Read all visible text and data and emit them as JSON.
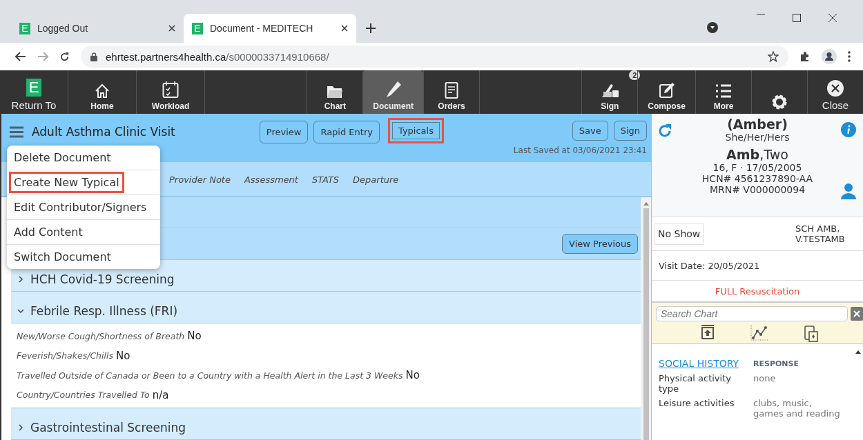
{
  "browser": {
    "tabs": [
      {
        "favicon": "E",
        "title": "Logged Out",
        "selected": false
      },
      {
        "favicon": "E",
        "title": "Document - MEDITECH",
        "selected": true
      }
    ],
    "url_host": "ehrtest.partners4health.ca",
    "url_path": "/s0000033714910668/"
  },
  "toolbar": {
    "items": [
      {
        "logo": "E",
        "label": "Return To",
        "selected": false
      },
      {
        "label": "Home",
        "selected": false
      },
      {
        "label": "Workload",
        "selected": false
      },
      {
        "label": "Chart",
        "selected": false
      },
      {
        "label": "Document",
        "selected": true
      },
      {
        "label": "Orders",
        "selected": false
      },
      {
        "label": "Sign",
        "selected": false,
        "badge": "2"
      },
      {
        "label": "Compose",
        "selected": false
      },
      {
        "label": "More",
        "selected": false
      },
      {
        "selected": false
      },
      {
        "label": "Close",
        "selected": false
      }
    ]
  },
  "document": {
    "title": "Adult Asthma Clinic Visit",
    "buttons": [
      {
        "label": "Preview",
        "highlighted": false
      },
      {
        "label": "Rapid Entry",
        "highlighted": false
      },
      {
        "label": "Typicals",
        "highlighted": true
      }
    ],
    "right_buttons": [
      {
        "label": "Save"
      },
      {
        "label": "Sign"
      }
    ],
    "last_saved": "Last Saved at 03/06/2021 23:41",
    "tabs": [
      "Provider Note",
      "Assessment",
      "STATS",
      "Departure"
    ],
    "view_previous": "View Previous",
    "sections": [
      {
        "title": "HCH Covid-19 Screening",
        "expanded": false
      },
      {
        "title": "Febrile Resp. Illness (FRI)",
        "expanded": true,
        "fields": [
          {
            "label": "New/Worse Cough/Shortness of Breath",
            "value": "No"
          },
          {
            "label": "Feverish/Shakes/Chills",
            "value": "No"
          },
          {
            "label": "Travelled Outside of Canada or Been to a Country with a Health Alert in the Last 3 Weeks",
            "value": "No"
          },
          {
            "label": "Country/Countries Travelled To",
            "value": "n/a"
          }
        ]
      },
      {
        "title": "Gastrointestinal Screening",
        "expanded": false
      }
    ]
  },
  "menu": {
    "items": [
      {
        "label": "Delete Document",
        "highlighted": false
      },
      {
        "label": "Create New Typical",
        "highlighted": true
      },
      {
        "label": "Edit Contributor/Signers",
        "highlighted": false
      },
      {
        "label": "Add Content",
        "highlighted": false
      },
      {
        "label": "Switch Document",
        "highlighted": false
      }
    ]
  },
  "patient": {
    "preferred_name": "(Amber)",
    "pronouns": "She/Her/Hers",
    "surname": "Amb",
    "given_name": ",Two",
    "age_sex_dob": "16, F · 17/05/2005",
    "hcn": "HCN# 4561237890-AA",
    "mrn": "MRN# V000000094",
    "status_button": "No Show",
    "provider": "SCH AMB, V.TESTAMB",
    "visit_date": "Visit Date: 20/05/2021",
    "code_status": "FULL Resuscitation",
    "search": {
      "placeholder": "Search Chart"
    },
    "history": {
      "heading": "SOCIAL HISTORY",
      "column": "RESPONSE",
      "rows": [
        {
          "label": "Physical activity type",
          "value": "none"
        },
        {
          "label": "Leisure activities",
          "value": "clubs, music, games and reading"
        }
      ]
    }
  }
}
